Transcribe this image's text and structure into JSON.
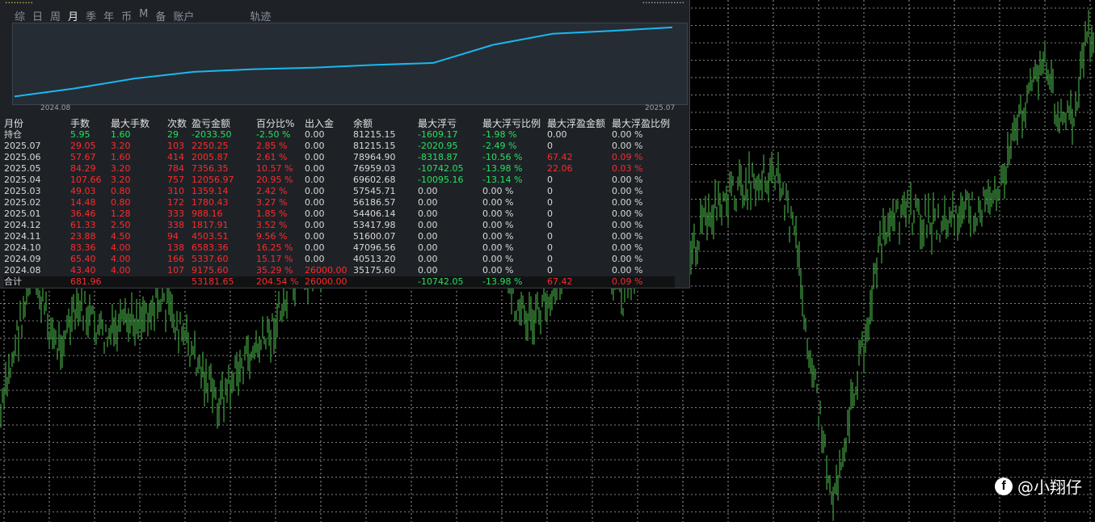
{
  "header": {
    "left_text": "..........",
    "right_text": "..............."
  },
  "tabs": [
    {
      "label": "综"
    },
    {
      "label": "日"
    },
    {
      "label": "周"
    },
    {
      "label": "月",
      "active": true
    },
    {
      "label": "季"
    },
    {
      "label": "年"
    },
    {
      "label": "币"
    },
    {
      "label": "M"
    },
    {
      "label": "备"
    },
    {
      "label": "账户"
    },
    {
      "label": "轨迹"
    }
  ],
  "equity_chart": {
    "x_start_label": "2024.08",
    "x_end_label": "2025.07",
    "line_color": "#19b8f0",
    "values": [
      35175.6,
      40513.2,
      47096.56,
      51600.07,
      53417.98,
      54406.14,
      56186.57,
      57545.71,
      69602.68,
      76959.03,
      78964.9,
      81215.15
    ]
  },
  "table": {
    "headers": [
      "月份",
      "手数",
      "最大手数",
      "次数",
      "盈亏金额",
      "百分比%",
      "出入金",
      "余额",
      "最大浮亏",
      "最大浮亏比例",
      "最大浮盈金额",
      "最大浮盈比例"
    ],
    "rows": [
      {
        "month": "持仓",
        "lots": "5.95",
        "max_lots": "1.60",
        "count": "29",
        "pnl": "-2033.50",
        "pct": "-2.50 %",
        "io": "0.00",
        "balance": "81215.15",
        "max_dd": "-1609.17",
        "max_dd_pct": "-1.98 %",
        "max_fp": "0.00",
        "max_fp_pct": "0.00 %",
        "color": "g"
      },
      {
        "month": "2025.07",
        "lots": "29.05",
        "max_lots": "3.20",
        "count": "103",
        "pnl": "2250.25",
        "pct": "2.85 %",
        "io": "0.00",
        "balance": "81215.15",
        "max_dd": "-2020.95",
        "max_dd_pct": "-2.49 %",
        "max_fp": "0",
        "max_fp_pct": "0.00 %",
        "color": "r"
      },
      {
        "month": "2025.06",
        "lots": "57.67",
        "max_lots": "1.60",
        "count": "414",
        "pnl": "2005.87",
        "pct": "2.61 %",
        "io": "0.00",
        "balance": "78964.90",
        "max_dd": "-8318.87",
        "max_dd_pct": "-10.56 %",
        "max_fp": "67.42",
        "max_fp_pct": "0.09 %",
        "color": "r",
        "fp_red": true
      },
      {
        "month": "2025.05",
        "lots": "84.29",
        "max_lots": "3.20",
        "count": "784",
        "pnl": "7356.35",
        "pct": "10.57 %",
        "io": "0.00",
        "balance": "76959.03",
        "max_dd": "-10742.05",
        "max_dd_pct": "-13.98 %",
        "max_fp": "22.06",
        "max_fp_pct": "0.03 %",
        "color": "r",
        "fp_red": true
      },
      {
        "month": "2025.04",
        "lots": "107.66",
        "max_lots": "3.20",
        "count": "757",
        "pnl": "12056.97",
        "pct": "20.95 %",
        "io": "0.00",
        "balance": "69602.68",
        "max_dd": "-10095.16",
        "max_dd_pct": "-13.14 %",
        "max_fp": "0",
        "max_fp_pct": "0.00 %",
        "color": "r"
      },
      {
        "month": "2025.03",
        "lots": "49.03",
        "max_lots": "0.80",
        "count": "310",
        "pnl": "1359.14",
        "pct": "2.42 %",
        "io": "0.00",
        "balance": "57545.71",
        "max_dd": "0.00",
        "max_dd_pct": "0.00 %",
        "max_fp": "0",
        "max_fp_pct": "0.00 %",
        "color": "r",
        "dd_white": true
      },
      {
        "month": "2025.02",
        "lots": "14.48",
        "max_lots": "0.80",
        "count": "172",
        "pnl": "1780.43",
        "pct": "3.27 %",
        "io": "0.00",
        "balance": "56186.57",
        "max_dd": "0.00",
        "max_dd_pct": "0.00 %",
        "max_fp": "0",
        "max_fp_pct": "0.00 %",
        "color": "r",
        "dd_white": true
      },
      {
        "month": "2025.01",
        "lots": "36.46",
        "max_lots": "1.28",
        "count": "333",
        "pnl": "988.16",
        "pct": "1.85 %",
        "io": "0.00",
        "balance": "54406.14",
        "max_dd": "0.00",
        "max_dd_pct": "0.00 %",
        "max_fp": "0",
        "max_fp_pct": "0.00 %",
        "color": "r",
        "dd_white": true
      },
      {
        "month": "2024.12",
        "lots": "61.33",
        "max_lots": "2.50",
        "count": "338",
        "pnl": "1817.91",
        "pct": "3.52 %",
        "io": "0.00",
        "balance": "53417.98",
        "max_dd": "0.00",
        "max_dd_pct": "0.00 %",
        "max_fp": "0",
        "max_fp_pct": "0.00 %",
        "color": "r",
        "dd_white": true
      },
      {
        "month": "2024.11",
        "lots": "23.88",
        "max_lots": "4.50",
        "count": "94",
        "pnl": "4503.51",
        "pct": "9.56 %",
        "io": "0.00",
        "balance": "51600.07",
        "max_dd": "0.00",
        "max_dd_pct": "0.00 %",
        "max_fp": "0",
        "max_fp_pct": "0.00 %",
        "color": "r",
        "dd_white": true
      },
      {
        "month": "2024.10",
        "lots": "83.36",
        "max_lots": "4.00",
        "count": "138",
        "pnl": "6583.36",
        "pct": "16.25 %",
        "io": "0.00",
        "balance": "47096.56",
        "max_dd": "0.00",
        "max_dd_pct": "0.00 %",
        "max_fp": "0",
        "max_fp_pct": "0.00 %",
        "color": "r",
        "dd_white": true
      },
      {
        "month": "2024.09",
        "lots": "65.40",
        "max_lots": "4.00",
        "count": "166",
        "pnl": "5337.60",
        "pct": "15.17 %",
        "io": "0.00",
        "balance": "40513.20",
        "max_dd": "0.00",
        "max_dd_pct": "0.00 %",
        "max_fp": "0",
        "max_fp_pct": "0.00 %",
        "color": "r",
        "dd_white": true
      },
      {
        "month": "2024.08",
        "lots": "43.40",
        "max_lots": "4.00",
        "count": "107",
        "pnl": "9175.60",
        "pct": "35.29 %",
        "io": "26000.00",
        "balance": "35175.60",
        "max_dd": "0.00",
        "max_dd_pct": "0.00 %",
        "max_fp": "0",
        "max_fp_pct": "0.00 %",
        "color": "r",
        "dd_white": true,
        "io_red": true
      }
    ],
    "total": {
      "month": "合计",
      "lots": "681.96",
      "pnl": "53181.65",
      "pct": "204.54 %",
      "io": "26000.00",
      "max_dd": "-10742.05",
      "max_dd_pct": "-13.98 %",
      "max_fp": "67.42",
      "max_fp_pct": "0.09 %"
    }
  },
  "watermark": {
    "icon": "facebook-icon",
    "text": "@小翔仔"
  },
  "colors": {
    "bull": "#4fc24f",
    "grid": "#ffffff",
    "panel": "#1e2227",
    "profit": "#ff2a2a",
    "loss": "#27e05a"
  }
}
